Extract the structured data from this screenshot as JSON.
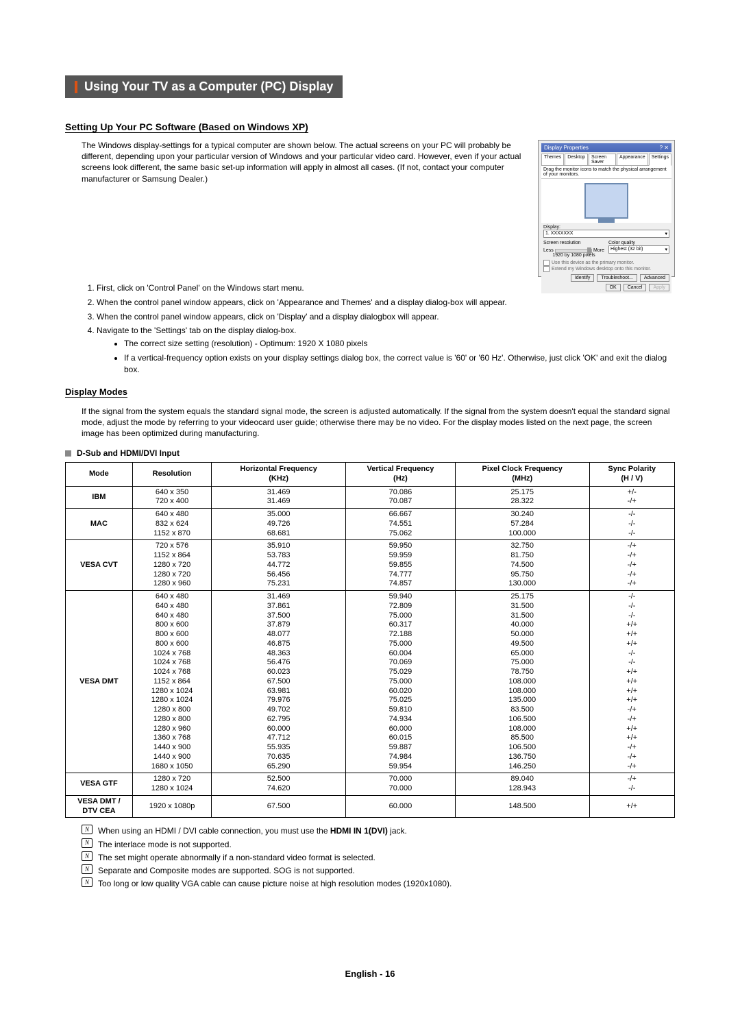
{
  "page_title": "Using Your TV as a Computer (PC) Display",
  "section1_heading": "Setting Up Your PC Software (Based on Windows XP)",
  "section1_intro": "The Windows display-settings for a typical computer are shown below. The actual screens on your PC will probably be different, depending upon your particular version of Windows and your particular video card. However, even if your actual screens look different, the same basic set-up information will apply in almost all cases. (If not, contact your computer manufacturer or Samsung Dealer.)",
  "steps": [
    "First, click on 'Control Panel' on the Windows start menu.",
    "When the control panel window appears, click on 'Appearance and Themes' and a display dialog-box will appear.",
    "When the control panel window appears, click on 'Display' and a display dialogbox will appear.",
    "Navigate to the 'Settings' tab on the display dialog-box."
  ],
  "step4_bullets": [
    "The correct size setting (resolution) - Optimum: 1920 X 1080 pixels",
    "If a vertical-frequency option exists on your display settings dialog box, the correct value is '60' or '60 Hz'. Otherwise, just click 'OK' and exit the dialog box."
  ],
  "section2_heading": "Display Modes",
  "section2_intro": "If the signal from the system equals the standard signal mode, the screen is adjusted automatically. If the signal from the system doesn't equal the standard signal mode, adjust the mode by referring to your videocard user guide; otherwise there may be no video. For the display modes listed on the next page, the screen image has been optimized during manufacturing.",
  "input_label": "D-Sub and HDMI/DVI Input",
  "headers": {
    "mode": "Mode",
    "resolution": "Resolution",
    "hf": "Horizontal Frequency\n(KHz)",
    "vf": "Vertical Frequency\n(Hz)",
    "px": "Pixel Clock Frequency\n(MHz)",
    "sp": "Sync Polarity\n(H / V)"
  },
  "chart_data": {
    "type": "table",
    "columns": [
      "Mode",
      "Resolution",
      "Horizontal Frequency (KHz)",
      "Vertical Frequency (Hz)",
      "Pixel Clock Frequency (MHz)",
      "Sync Polarity (H / V)"
    ],
    "groups": [
      {
        "mode": "IBM",
        "rows": [
          [
            "640 x 350",
            "31.469",
            "70.086",
            "25.175",
            "+/-"
          ],
          [
            "720 x 400",
            "31.469",
            "70.087",
            "28.322",
            "-/+"
          ]
        ]
      },
      {
        "mode": "MAC",
        "rows": [
          [
            "640 x 480",
            "35.000",
            "66.667",
            "30.240",
            "-/-"
          ],
          [
            "832 x 624",
            "49.726",
            "74.551",
            "57.284",
            "-/-"
          ],
          [
            "1152 x 870",
            "68.681",
            "75.062",
            "100.000",
            "-/-"
          ]
        ]
      },
      {
        "mode": "VESA CVT",
        "rows": [
          [
            "720 x 576",
            "35.910",
            "59.950",
            "32.750",
            "-/+"
          ],
          [
            "1152 x 864",
            "53.783",
            "59.959",
            "81.750",
            "-/+"
          ],
          [
            "1280 x 720",
            "44.772",
            "59.855",
            "74.500",
            "-/+"
          ],
          [
            "1280 x 720",
            "56.456",
            "74.777",
            "95.750",
            "-/+"
          ],
          [
            "1280 x 960",
            "75.231",
            "74.857",
            "130.000",
            "-/+"
          ]
        ]
      },
      {
        "mode": "VESA DMT",
        "rows": [
          [
            "640 x 480",
            "31.469",
            "59.940",
            "25.175",
            "-/-"
          ],
          [
            "640 x 480",
            "37.861",
            "72.809",
            "31.500",
            "-/-"
          ],
          [
            "640 x 480",
            "37.500",
            "75.000",
            "31.500",
            "-/-"
          ],
          [
            "800 x 600",
            "37.879",
            "60.317",
            "40.000",
            "+/+"
          ],
          [
            "800 x 600",
            "48.077",
            "72.188",
            "50.000",
            "+/+"
          ],
          [
            "800 x 600",
            "46.875",
            "75.000",
            "49.500",
            "+/+"
          ],
          [
            "1024 x 768",
            "48.363",
            "60.004",
            "65.000",
            "-/-"
          ],
          [
            "1024 x 768",
            "56.476",
            "70.069",
            "75.000",
            "-/-"
          ],
          [
            "1024 x 768",
            "60.023",
            "75.029",
            "78.750",
            "+/+"
          ],
          [
            "1152 x 864",
            "67.500",
            "75.000",
            "108.000",
            "+/+"
          ],
          [
            "1280 x 1024",
            "63.981",
            "60.020",
            "108.000",
            "+/+"
          ],
          [
            "1280 x 1024",
            "79.976",
            "75.025",
            "135.000",
            "+/+"
          ],
          [
            "1280 x 800",
            "49.702",
            "59.810",
            "83.500",
            "-/+"
          ],
          [
            "1280 x 800",
            "62.795",
            "74.934",
            "106.500",
            "-/+"
          ],
          [
            "1280 x 960",
            "60.000",
            "60.000",
            "108.000",
            "+/+"
          ],
          [
            "1360 x 768",
            "47.712",
            "60.015",
            "85.500",
            "+/+"
          ],
          [
            "1440 x 900",
            "55.935",
            "59.887",
            "106.500",
            "-/+"
          ],
          [
            "1440 x 900",
            "70.635",
            "74.984",
            "136.750",
            "-/+"
          ],
          [
            "1680 x 1050",
            "65.290",
            "59.954",
            "146.250",
            "-/+"
          ]
        ]
      },
      {
        "mode": "VESA GTF",
        "rows": [
          [
            "1280 x 720",
            "52.500",
            "70.000",
            "89.040",
            "-/+"
          ],
          [
            "1280 x 1024",
            "74.620",
            "70.000",
            "128.943",
            "-/-"
          ]
        ]
      },
      {
        "mode": "VESA DMT /\nDTV CEA",
        "rows": [
          [
            "1920 x 1080p",
            "67.500",
            "60.000",
            "148.500",
            "+/+"
          ]
        ]
      }
    ]
  },
  "notes": [
    {
      "prefix": "When using an HDMI / DVI cable connection, you must use the ",
      "bold": "HDMI IN 1(DVI)",
      "suffix": " jack."
    },
    {
      "prefix": "The interlace mode is not supported.",
      "bold": "",
      "suffix": ""
    },
    {
      "prefix": "The set might operate abnormally if a non-standard video format is selected.",
      "bold": "",
      "suffix": ""
    },
    {
      "prefix": "Separate and Composite modes are supported. SOG is not supported.",
      "bold": "",
      "suffix": ""
    },
    {
      "prefix": "Too long or low quality VGA cable can cause picture noise at high resolution modes (1920x1080).",
      "bold": "",
      "suffix": ""
    }
  ],
  "note_icon_text": "N",
  "props_dialog": {
    "title": "Display Properties",
    "tabs": [
      "Themes",
      "Desktop",
      "Screen Saver",
      "Appearance",
      "Settings"
    ],
    "hint": "Drag the monitor icons to match the physical arrangement of your monitors.",
    "display_label": "Display:",
    "display_value": "1. XXXXXXX",
    "res_label": "Screen resolution",
    "res_less": "Less",
    "res_more": "More",
    "res_value": "1920 by 1080 pixels",
    "color_label": "Color quality",
    "color_value": "Highest (32 bit)",
    "check1": "Use this device as the primary monitor.",
    "check2": "Extend my Windows desktop onto this monitor.",
    "btn_identify": "Identify",
    "btn_troubleshoot": "Troubleshoot...",
    "btn_advanced": "Advanced",
    "btn_ok": "OK",
    "btn_cancel": "Cancel",
    "btn_apply": "Apply"
  },
  "footer": "English - 16"
}
